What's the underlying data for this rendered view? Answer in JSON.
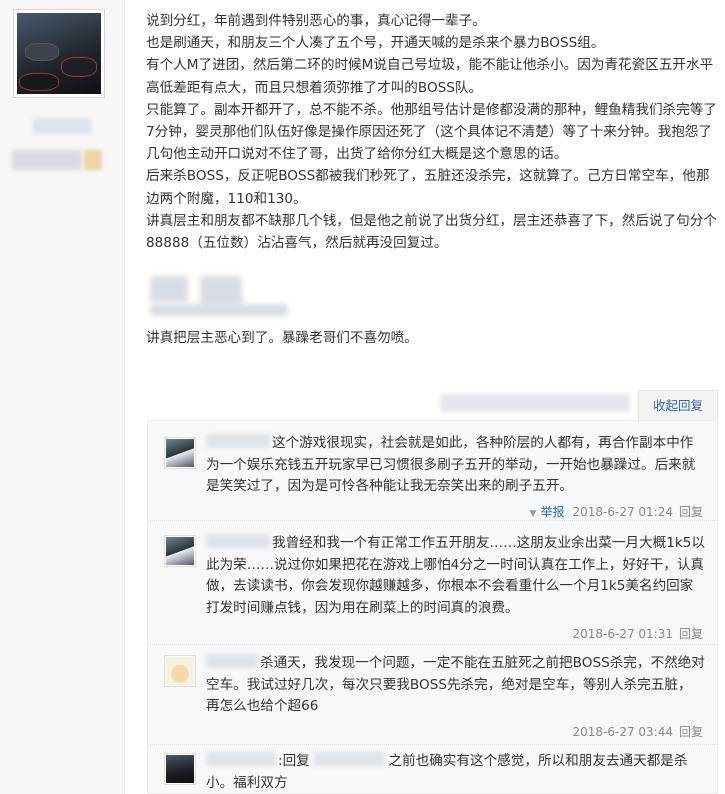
{
  "post": {
    "paragraphs": [
      "说到分红，年前遇到件特别恶心的事，真心记得一辈子。",
      "也是刷通天，和朋友三个人凑了五个号，开通天喊的是杀来个暴力BOSS组。",
      "有个人M了进团，然后第二环的时候M说自己号垃圾，能不能让他杀小。因为青花瓷区五开水平高低差距有点大，而且只想着须弥推了才叫的BOSS队。",
      "只能算了。副本开都开了，总不能不杀。他那组号估计是修都没满的那种，鲤鱼精我们杀完等了7分钟，婴灵那他们队伍好像是操作原因还死了（这个具体记不清楚）等了十来分钟。我抱怨了几句他主动开口说对不住了哥，出货了给你分红大概是这个意思的话。",
      "后来杀BOSS，反正呢BOSS都被我们秒死了，五脏还没杀完，这就算了。己方日常空车，他那边两个附魔，110和130。",
      "讲真层主和朋友都不缺那几个钱，但是他之前说了出货分红，层主还恭喜了下，然后说了句分个88888（五位数）沾沾喜气，然后就再没回复过。"
    ],
    "closing": "讲真把层主恶心到了。暴躁老哥们不喜勿喷。"
  },
  "tail": {
    "toggle_label": "收起回复"
  },
  "replies": [
    {
      "text": "这个游戏很现实，社会就是如此，各种阶层的人都有，再合作副本中作为一个娱乐充钱五开玩家早已习惯很多刷子五开的举动，一开始也暴躁过。后来就是笑笑过了，因为是可怜各种能让我无奈笑出来的刷子五开。",
      "report": "举报",
      "time": "2018-6-27 01:24",
      "reply_label": "回复"
    },
    {
      "text": "我曾经和我一个有正常工作五开朋友……这朋友业余出菜一月大概1k5以此为荣……说过你如果把花在游戏上哪怕4分之一时间认真在工作上，好好干，认真做，去读读书，你会发现你越赚越多，你根本不会看重什么一个月1k5美名约回家打发时间赚点钱，因为用在刷菜上的时间真的浪费。",
      "time": "2018-6-27 01:31",
      "reply_label": "回复"
    },
    {
      "text": "杀通天，我发现一个问题，一定不能在五脏死之前把BOSS杀完，不然绝对空车。我试过好几次，每次只要我BOSS先杀完，绝对是空车，等别人杀完五脏，再怎么也给个超66",
      "time": "2018-6-27 03:44",
      "reply_label": "回复"
    },
    {
      "prefix": ":回复",
      "text": "之前也确实有这个感觉，所以和朋友去通天都是杀小。福利双方"
    }
  ]
}
